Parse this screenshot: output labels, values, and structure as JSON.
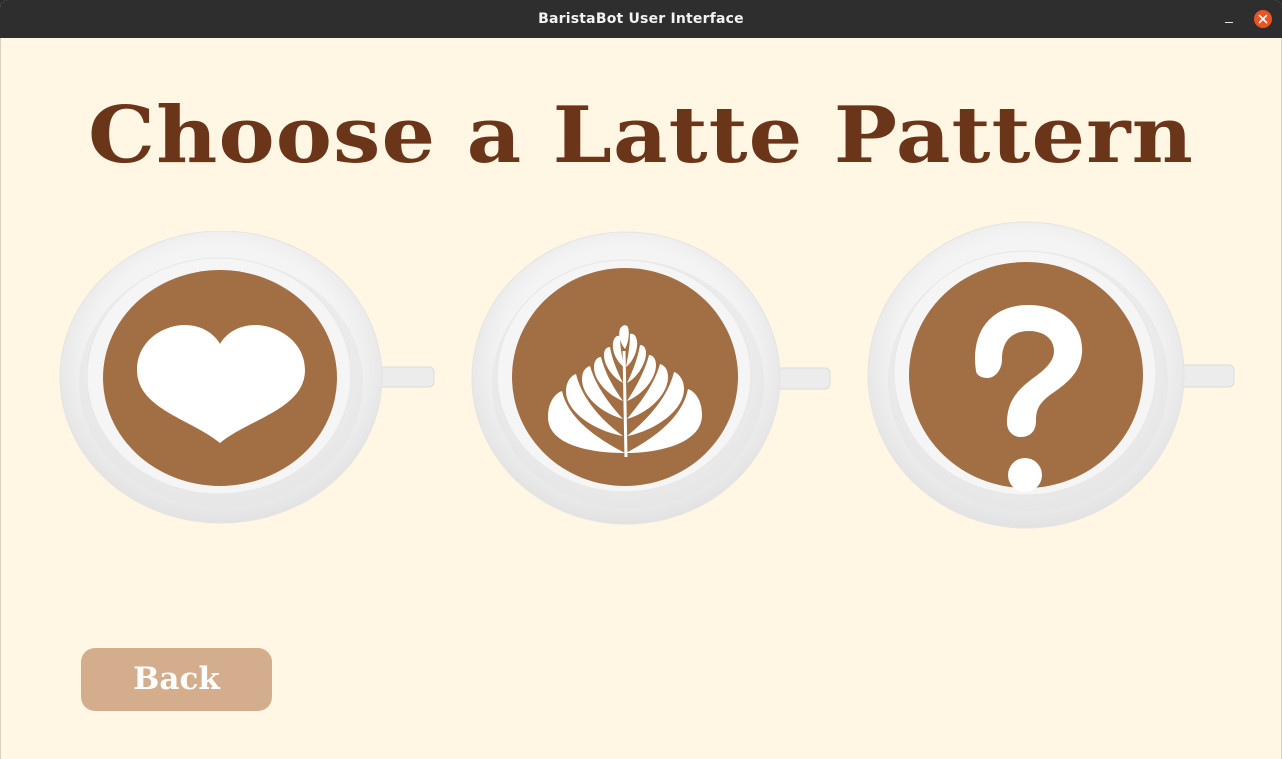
{
  "window": {
    "title": "BaristaBot User Interface"
  },
  "main": {
    "heading": "Choose a Latte Pattern",
    "patterns": [
      {
        "name": "heart",
        "icon": "heart-icon"
      },
      {
        "name": "rosetta",
        "icon": "rosetta-leaf-icon"
      },
      {
        "name": "surprise",
        "icon": "question-mark-icon"
      }
    ],
    "back_label": "Back"
  },
  "colors": {
    "background": "#fff6e4",
    "title": "#6b3519",
    "coffee": "#a26f45",
    "button": "#d3ad8c",
    "titlebar": "#2f2e2e",
    "close": "#e95420"
  }
}
